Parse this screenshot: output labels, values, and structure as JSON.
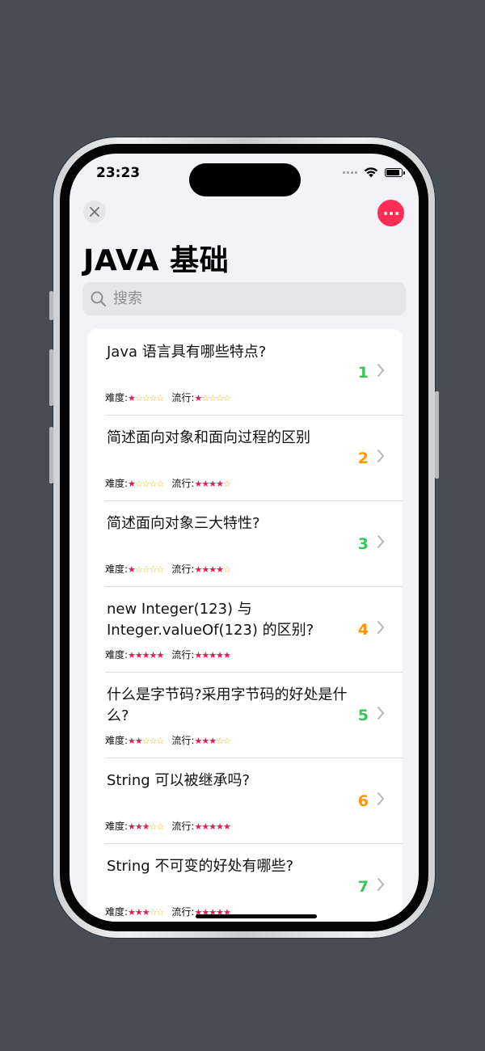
{
  "status_bar": {
    "time": "23:23",
    "icons": [
      "signal-icon",
      "wifi-icon",
      "battery-icon"
    ]
  },
  "nav": {
    "close_icon": "close-icon",
    "more_icon": "ellipsis-icon",
    "accent_color": "#ff2d55"
  },
  "page": {
    "title": "JAVA 基础"
  },
  "search": {
    "placeholder": "搜索",
    "value": ""
  },
  "labels": {
    "difficulty": "难度:",
    "popularity": "流行:"
  },
  "colors": {
    "green": "#34c759",
    "orange": "#ff9500",
    "star_on": "#e8194f",
    "star_off": "#e8b400"
  },
  "questions": [
    {
      "title": "Java 语言具有哪些特点?",
      "number": "1",
      "number_color": "green",
      "difficulty": 1,
      "popularity": 1
    },
    {
      "title": "简述面向对象和面向过程的区别",
      "number": "2",
      "number_color": "orange",
      "difficulty": 1,
      "popularity": 4
    },
    {
      "title": "简述面向对象三大特性?",
      "number": "3",
      "number_color": "green",
      "difficulty": 1,
      "popularity": 4
    },
    {
      "title": "new Integer(123) 与 Integer.valueOf(123) 的区别?",
      "number": "4",
      "number_color": "orange",
      "difficulty": 5,
      "popularity": 5
    },
    {
      "title": "什么是字节码?采用字节码的好处是什么?",
      "number": "5",
      "number_color": "green",
      "difficulty": 2,
      "popularity": 3
    },
    {
      "title": "String 可以被继承吗?",
      "number": "6",
      "number_color": "orange",
      "difficulty": 3,
      "popularity": 5
    },
    {
      "title": "String 不可变的好处有哪些?",
      "number": "7",
      "number_color": "green",
      "difficulty": 3,
      "popularity": 5
    }
  ]
}
